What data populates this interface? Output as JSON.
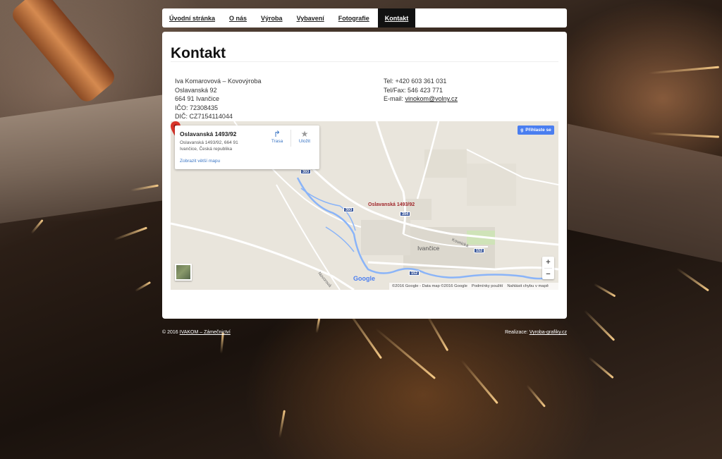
{
  "nav": {
    "items": [
      {
        "label": "Úvodní stránka"
      },
      {
        "label": "O nás"
      },
      {
        "label": "Výroba"
      },
      {
        "label": "Vybavení"
      },
      {
        "label": "Fotografie"
      },
      {
        "label": "Kontakt",
        "active": true
      }
    ]
  },
  "page": {
    "title": "Kontakt"
  },
  "address": {
    "company": "Iva Komarovová – Kovovýroba",
    "street": "Oslavanská 92",
    "city": "664 91 Ivančice",
    "ico": "IČO: 72308435",
    "dic": "DIČ: CZ7154114044"
  },
  "contact": {
    "phone": "Tel: +420 603 361 031",
    "fax": "Tel/Fax: 546 423 771",
    "email_label": "E-mail: ",
    "email": "vinokom@volny.cz"
  },
  "map": {
    "card_title": "Oslavanská 1493/92",
    "card_line1": "Oslavanská 1493/92, 664 91",
    "card_line2": "Ivančice, Česká republika",
    "card_link": "Zobrazit větší mapu",
    "directions_label": "Trasa",
    "save_label": "Uložit",
    "signin_label": "Přihlaste se",
    "pin_label": "Oslavanská 1493/92",
    "town_label": "Ivančice",
    "road_labels": [
      "Novorouá",
      "Kounická"
    ],
    "road_shields": [
      "393",
      "393",
      "394",
      "152",
      "152"
    ],
    "zoom_in": "+",
    "zoom_out": "−",
    "google_logo": "Google",
    "attribution": "©2016 Google - Data map ©2016 Google",
    "terms": "Podmínky použití",
    "report": "Nahlásit chybu v mapě"
  },
  "footer": {
    "left_prefix": "© 2016 ",
    "left_link": "IVAKOM – Zámečnictví",
    "right_prefix": "Realizace: ",
    "right_link": "Vyroba-grafiky.cz"
  },
  "colors": {
    "nav_active_bg": "#111111",
    "map_link": "#3a75c4",
    "pin": "#d9352a",
    "signin_bg": "#4a7ef0"
  }
}
